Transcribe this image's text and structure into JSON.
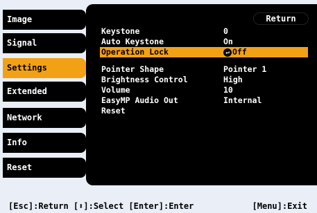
{
  "menu": [
    {
      "label": "Image",
      "selected": false
    },
    {
      "label": "Signal",
      "selected": false
    },
    {
      "label": "Settings",
      "selected": true
    },
    {
      "label": "Extended",
      "selected": false
    },
    {
      "label": "Network",
      "selected": false
    },
    {
      "label": "Info",
      "selected": false
    },
    {
      "label": "Reset",
      "selected": false
    }
  ],
  "panel": {
    "return_label": "Return",
    "rows": [
      {
        "label": "Keystone",
        "value": "0"
      },
      {
        "label": "Auto Keystone",
        "value": "On"
      },
      {
        "label": "Operation Lock",
        "value": "Off",
        "highlight": true
      },
      {
        "label": "Pointer Shape",
        "value": "Pointer 1"
      },
      {
        "label": "Brightness Control",
        "value": "High"
      },
      {
        "label": "Volume",
        "value": "10"
      },
      {
        "label": "EasyMP Audio Out",
        "value": "Internal"
      },
      {
        "label": "Reset",
        "value": ""
      }
    ]
  },
  "status": {
    "left": "[Esc]:Return [⬍]:Select [Enter]:Enter",
    "right": "[Menu]:Exit"
  },
  "colors": {
    "highlight": "#f3a114",
    "background": "#e9eef7",
    "panel": "#000000"
  }
}
